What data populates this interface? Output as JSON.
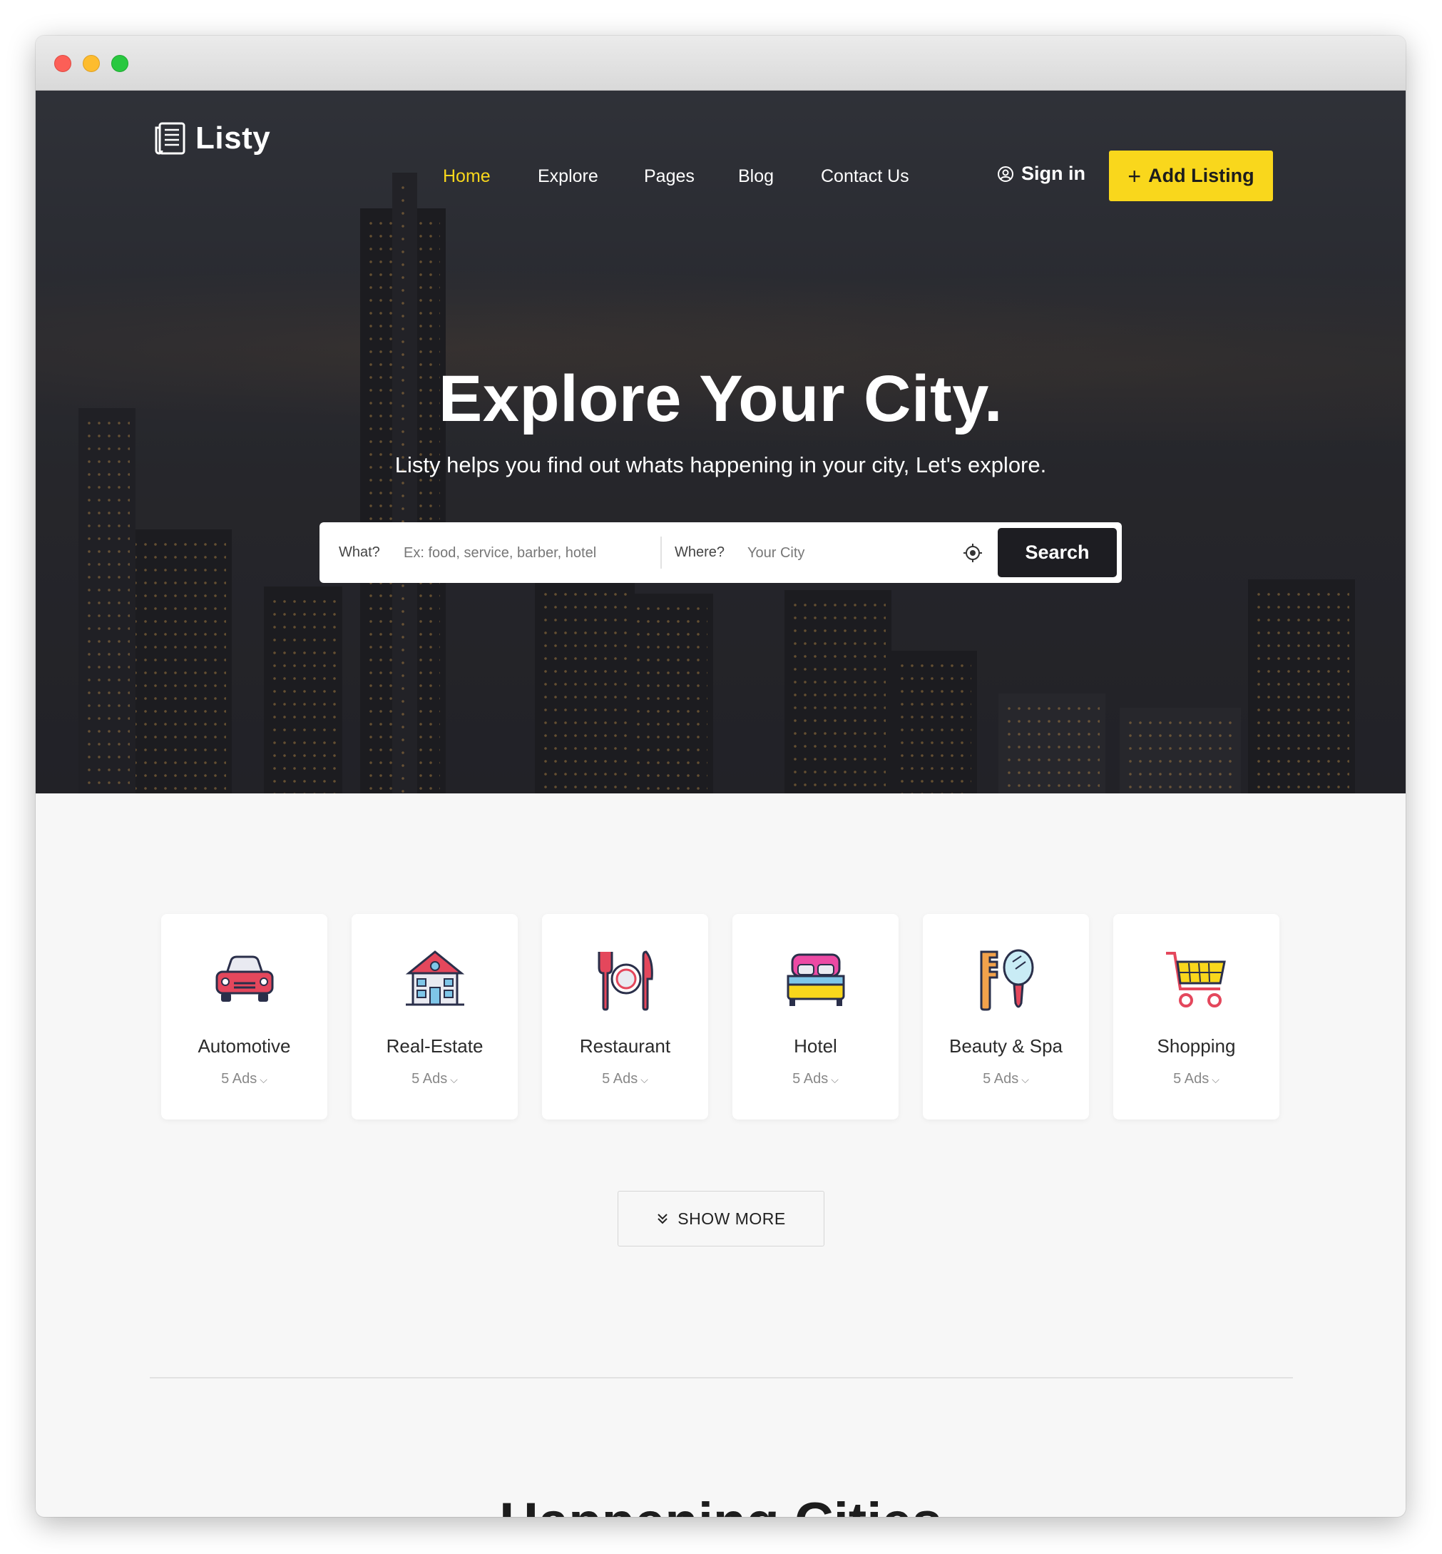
{
  "brand": {
    "name": "Listy"
  },
  "nav": {
    "links": [
      "Home",
      "Explore",
      "Pages",
      "Blog",
      "Contact Us"
    ],
    "sign_in": "Sign in",
    "add_listing": "Add Listing",
    "accent_color": "#f9d71c"
  },
  "hero": {
    "title": "Explore Your City.",
    "subtitle": "Listy helps you find out whats happening in your city, Let's explore."
  },
  "search": {
    "what_label": "What?",
    "what_placeholder": "Ex: food, service, barber, hotel",
    "where_label": "Where?",
    "where_placeholder": "Your City",
    "button": "Search"
  },
  "categories": [
    {
      "name": "Automotive",
      "count": "5 Ads",
      "icon": "car-icon"
    },
    {
      "name": "Real-Estate",
      "count": "5 Ads",
      "icon": "house-icon"
    },
    {
      "name": "Restaurant",
      "count": "5 Ads",
      "icon": "restaurant-icon"
    },
    {
      "name": "Hotel",
      "count": "5 Ads",
      "icon": "bed-icon"
    },
    {
      "name": "Beauty & Spa",
      "count": "5 Ads",
      "icon": "comb-mirror-icon"
    },
    {
      "name": "Shopping",
      "count": "5 Ads",
      "icon": "shopping-cart-icon"
    }
  ],
  "show_more": "SHOW MORE",
  "next_section_title": "Happening Cities"
}
